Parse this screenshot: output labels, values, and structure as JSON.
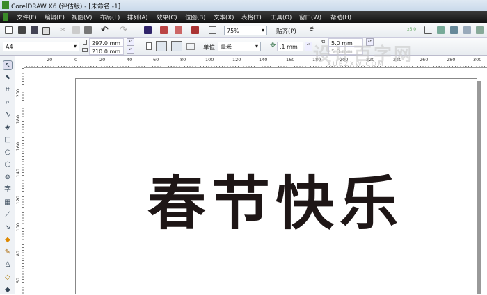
{
  "window": {
    "title": "CorelDRAW X6 (评估版) - [未命名 -1]"
  },
  "menu": [
    "文件(F)",
    "编辑(E)",
    "视图(V)",
    "布局(L)",
    "排列(A)",
    "效果(C)",
    "位图(B)",
    "文本(X)",
    "表格(T)",
    "工具(O)",
    "窗口(W)",
    "帮助(H)"
  ],
  "toolbar": {
    "zoom": "75%",
    "snap": "贴齐(P)"
  },
  "property_bar": {
    "page_size": "A4",
    "width": "297.0 mm",
    "height": "210.0 mm",
    "unit_label": "单位:",
    "unit": "毫米",
    "nudge": ".1 mm",
    "dup_x": "5.0 mm",
    "dup_y": "5.0 mm"
  },
  "rulers": {
    "horizontal": [
      "20",
      "0",
      "20",
      "40",
      "60",
      "80",
      "100",
      "120",
      "140",
      "160",
      "180",
      "200",
      "220",
      "240",
      "260",
      "280",
      "300"
    ],
    "vertical": [
      "200",
      "180",
      "160",
      "140",
      "120",
      "100",
      "80",
      "60"
    ]
  },
  "tools": [
    "pick",
    "shape",
    "crop",
    "zoom",
    "freehand",
    "smart-fill",
    "rectangle",
    "ellipse",
    "polygon",
    "basic-shapes",
    "text",
    "table",
    "dimension",
    "connector",
    "blend",
    "eyedropper",
    "outline",
    "fill"
  ],
  "canvas": {
    "text": "春节快乐"
  },
  "watermark": {
    "text": "设计百字网",
    "url": "XUEZXW.COM"
  }
}
